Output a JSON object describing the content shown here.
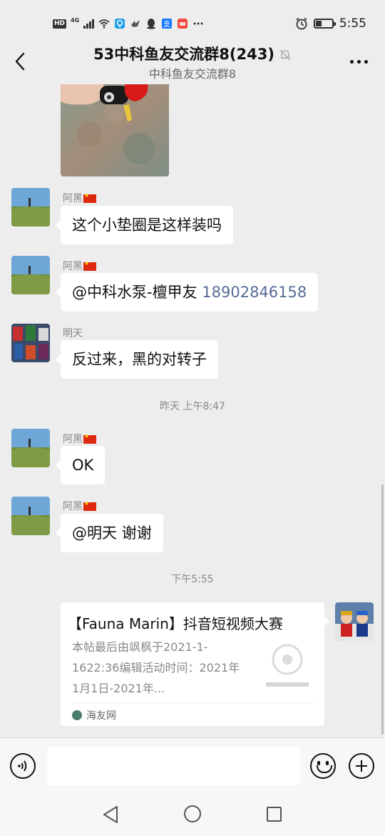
{
  "status_bar": {
    "time": "5:55",
    "network": "4G",
    "hd_label": "HD"
  },
  "header": {
    "title": "53中科鱼友交流群8(243)",
    "subtitle": "中科鱼友交流群8"
  },
  "messages": [
    {
      "sender": "阿黑",
      "text": "这个小垫圈是这样装吗"
    },
    {
      "sender": "阿黑",
      "text_prefix": "@中科水泵-檀甲友 ",
      "phone": "18902846158"
    },
    {
      "sender": "明天",
      "text": "反过来，黑的对转子"
    },
    {
      "sender": "阿黑",
      "text": "OK"
    },
    {
      "sender": "阿黑",
      "text": "@明天  谢谢"
    }
  ],
  "timestamps": [
    "昨天 上午8:47",
    "下午5:55"
  ],
  "shared_card": {
    "title": "【Fauna Marin】抖音短视频大赛",
    "description": "本帖最后由飒枫于2021-1-1622:36编辑活动时间：2021年1月1日-2021年...",
    "source": "海友网"
  },
  "icons": {
    "back": "chevron-left-icon",
    "mute": "bell-off-icon",
    "more": "more-dots-icon",
    "voice": "voice-icon",
    "emoji": "emoji-icon",
    "plus": "plus-icon"
  },
  "colors": {
    "background": "#ededed",
    "bubble": "#ffffff",
    "link": "#576b95"
  }
}
